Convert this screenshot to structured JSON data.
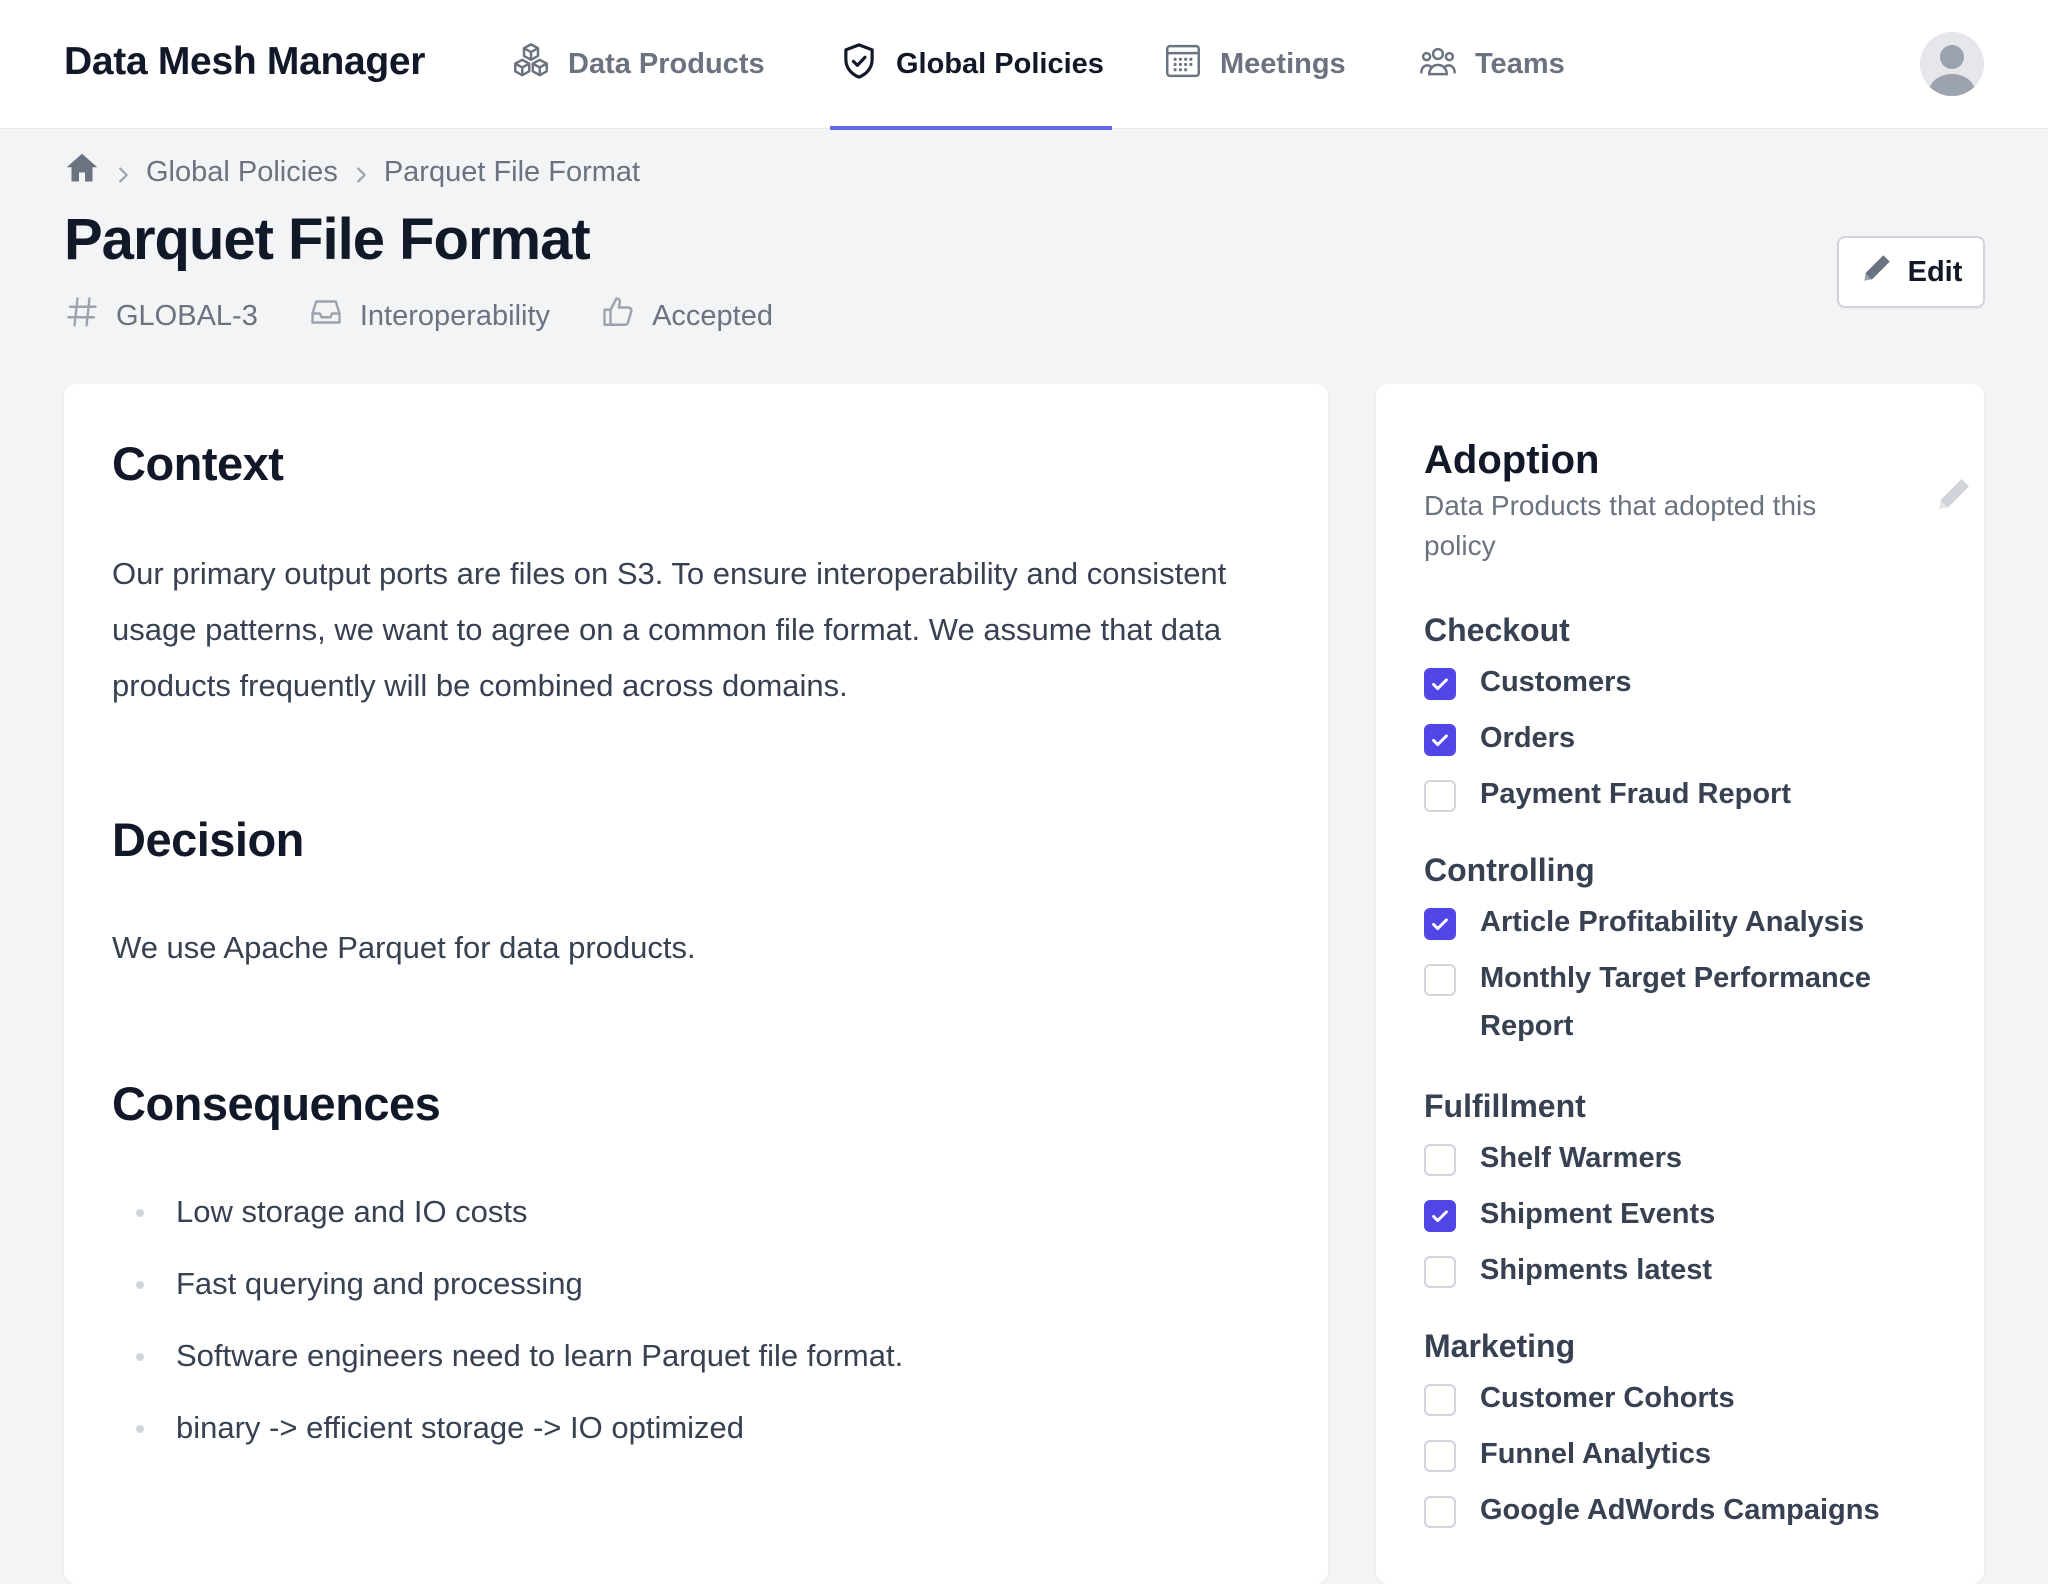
{
  "app": {
    "brand": "Data Mesh Manager"
  },
  "nav": {
    "data_products": "Data Products",
    "global_policies": "Global Policies",
    "meetings": "Meetings",
    "teams": "Teams"
  },
  "breadcrumb": {
    "items": [
      "Global Policies",
      "Parquet File Format"
    ]
  },
  "page": {
    "title": "Parquet File Format",
    "id": "GLOBAL-3",
    "category": "Interoperability",
    "status": "Accepted",
    "edit_label": "Edit"
  },
  "content": {
    "context_heading": "Context",
    "context_text": "Our primary output ports are files on S3. To ensure interoperability and consistent usage patterns, we want to agree on a common file format. We assume that data products frequently will be combined across domains.",
    "decision_heading": "Decision",
    "decision_text": "We use Apache Parquet for data products.",
    "consequences_heading": "Consequences",
    "consequences": [
      "Low storage and IO costs",
      "Fast querying and processing",
      "Software engineers need to learn Parquet file format.",
      "binary -> efficient storage -> IO optimized"
    ]
  },
  "adoption": {
    "title": "Adoption",
    "subtitle": "Data Products that adopted this policy",
    "groups": [
      {
        "name": "Checkout",
        "items": [
          {
            "label": "Customers",
            "checked": true
          },
          {
            "label": "Orders",
            "checked": true
          },
          {
            "label": "Payment Fraud Report",
            "checked": false
          }
        ]
      },
      {
        "name": "Controlling",
        "items": [
          {
            "label": "Article Profitability Analysis",
            "checked": true
          },
          {
            "label": "Monthly Target Performance Report",
            "checked": false
          }
        ]
      },
      {
        "name": "Fulfillment",
        "items": [
          {
            "label": "Shelf Warmers",
            "checked": false
          },
          {
            "label": "Shipment Events",
            "checked": true
          },
          {
            "label": "Shipments latest",
            "checked": false
          }
        ]
      },
      {
        "name": "Marketing",
        "items": [
          {
            "label": "Customer Cohorts",
            "checked": false
          },
          {
            "label": "Funnel Analytics",
            "checked": false
          },
          {
            "label": "Google AdWords Campaigns",
            "checked": false
          }
        ]
      }
    ]
  },
  "colors": {
    "accent": "#6366f1",
    "checkbox_checked": "#4f46e5",
    "text_primary": "#111827",
    "text_muted": "#6b7280",
    "background": "#f3f4f6"
  },
  "icons": {
    "data_products": "cubes-icon",
    "global_policies": "shield-check-icon",
    "meetings": "calendar-icon",
    "teams": "users-icon",
    "home": "home-icon",
    "id": "hashtag-icon",
    "category": "inbox-icon",
    "status": "thumb-up-icon",
    "edit": "pencil-icon"
  }
}
